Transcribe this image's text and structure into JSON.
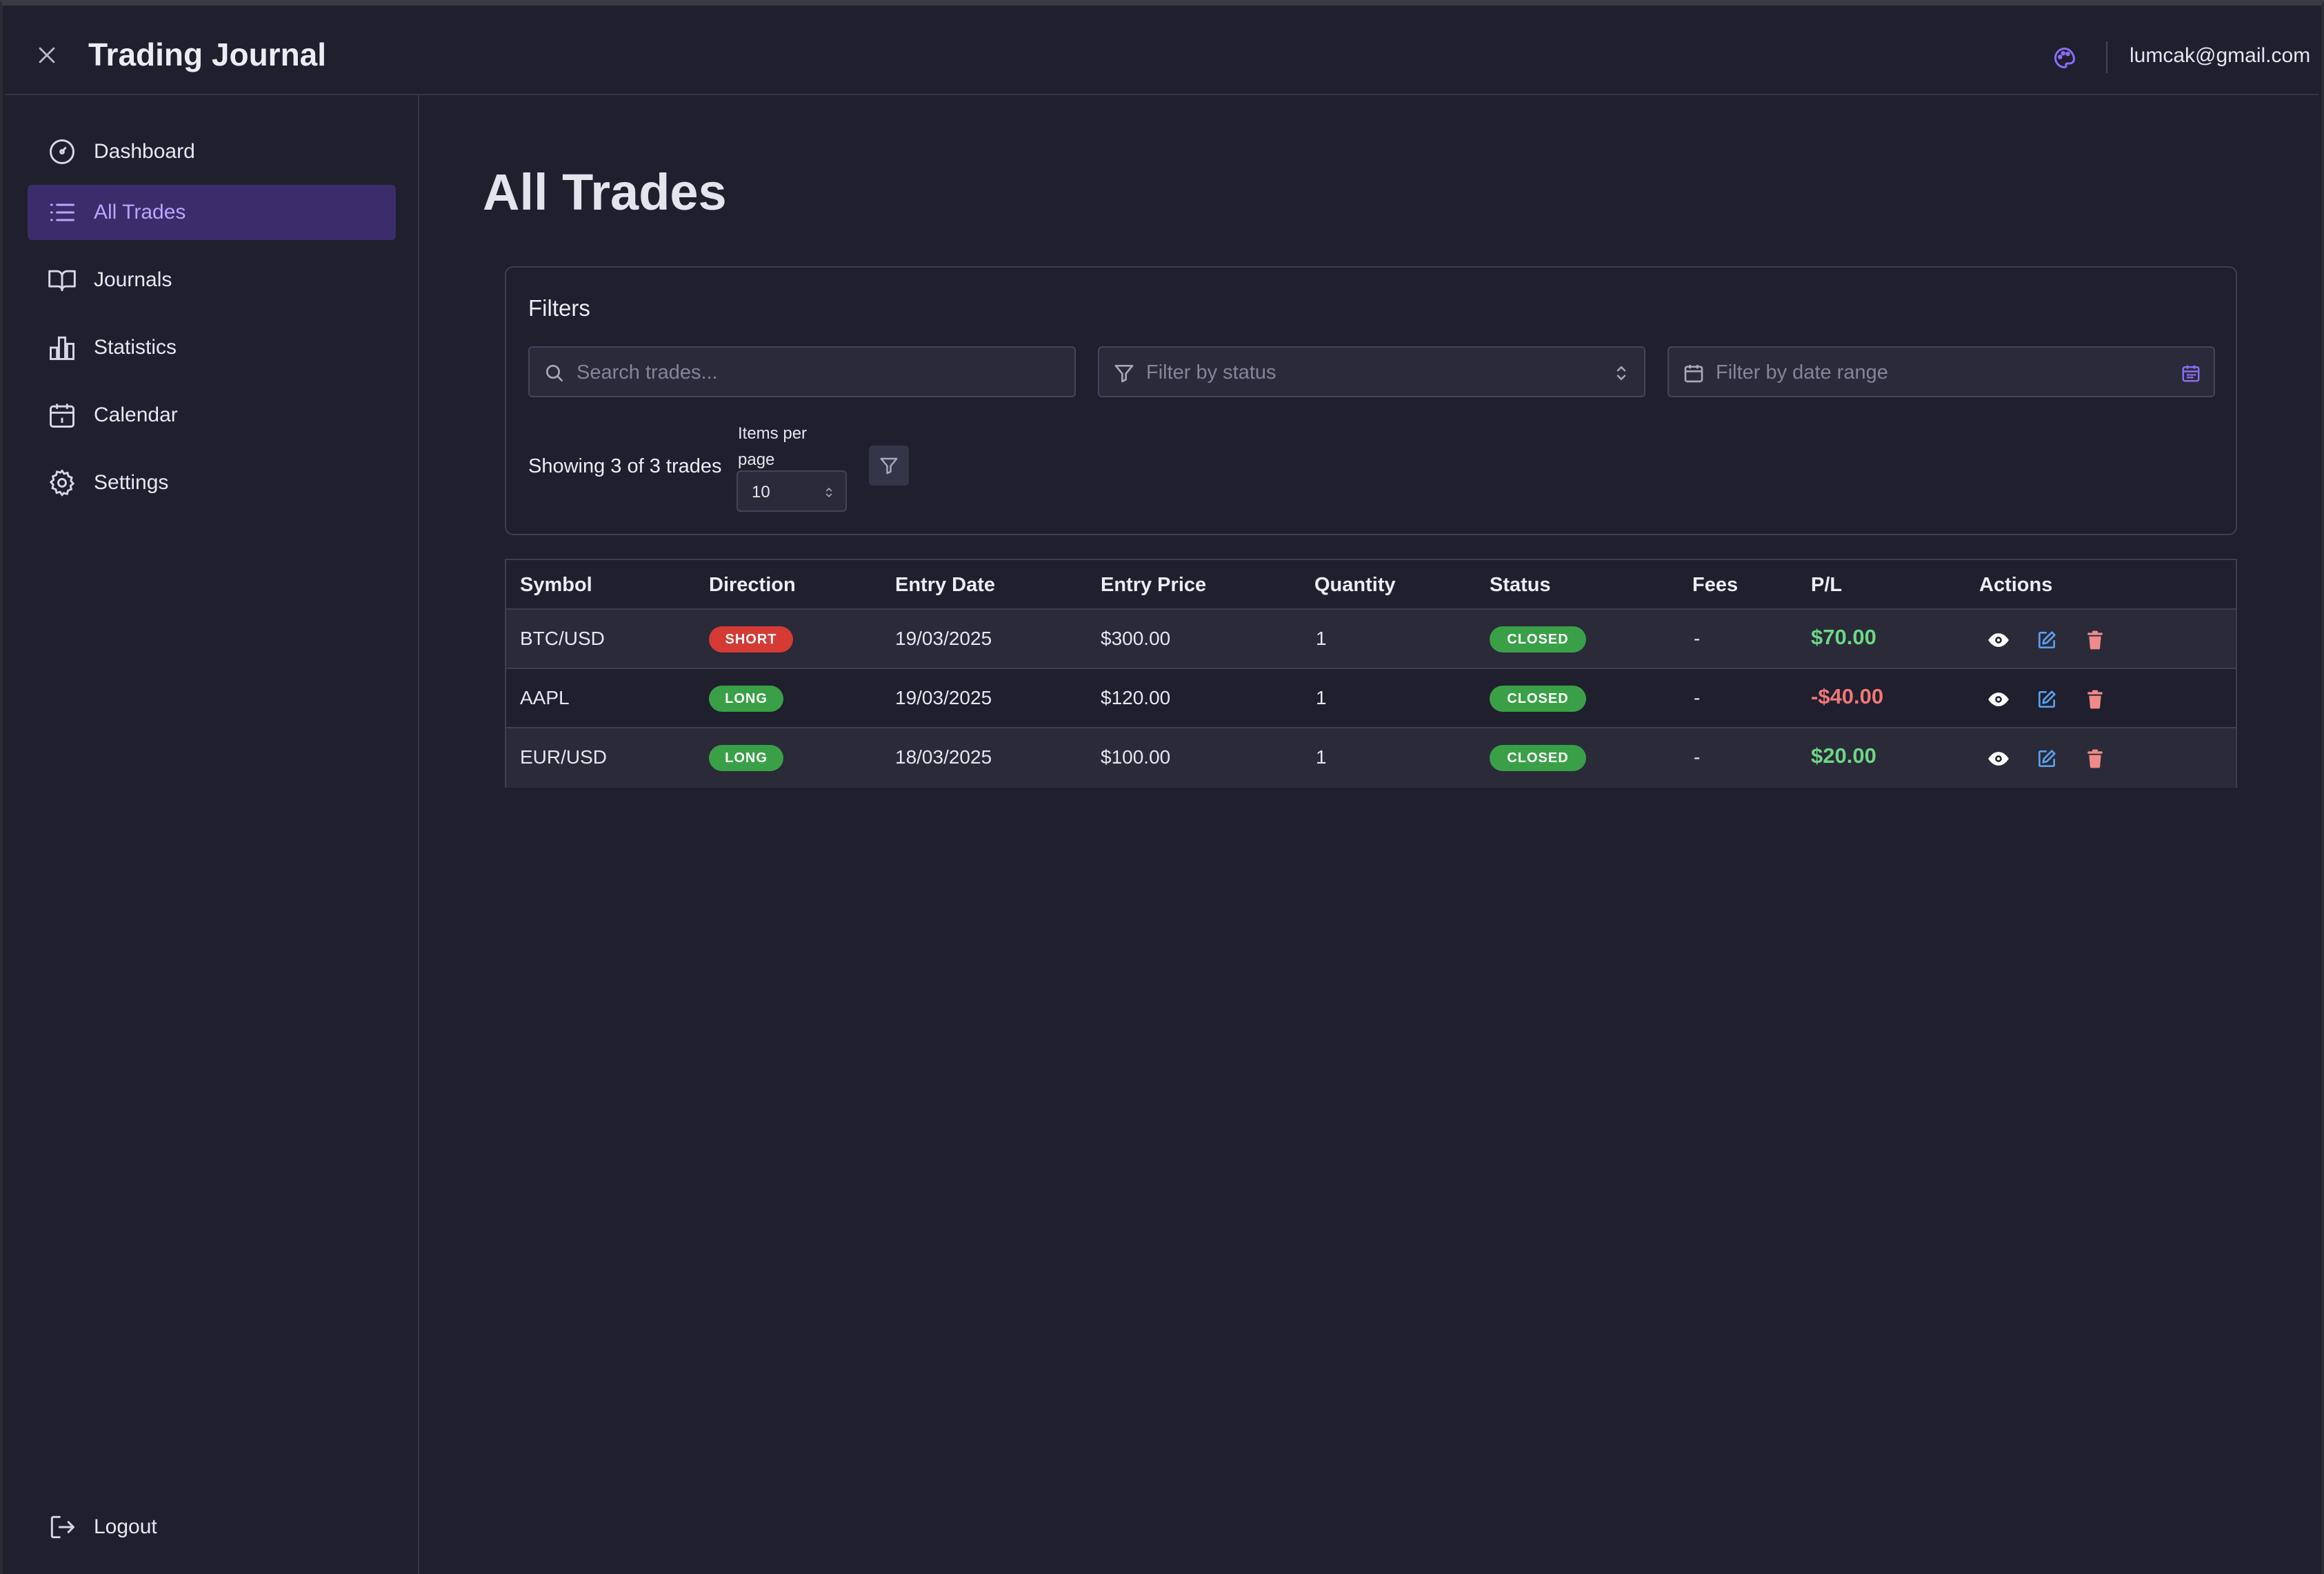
{
  "header": {
    "title": "Trading Journal",
    "user_email": "lumcak@gmail.com"
  },
  "sidebar": {
    "items": [
      {
        "label": "Dashboard",
        "icon": "gauge-icon"
      },
      {
        "label": "All Trades",
        "icon": "list-icon",
        "active": true
      },
      {
        "label": "Journals",
        "icon": "book-icon"
      },
      {
        "label": "Statistics",
        "icon": "bar-chart-icon"
      },
      {
        "label": "Calendar",
        "icon": "calendar-icon"
      },
      {
        "label": "Settings",
        "icon": "gear-icon"
      }
    ],
    "logout_label": "Logout"
  },
  "main": {
    "title": "All Trades",
    "filters": {
      "title": "Filters",
      "search_placeholder": "Search trades...",
      "status_placeholder": "Filter by status",
      "date_placeholder": "Filter by date range",
      "showing_text": "Showing 3 of 3 trades",
      "items_per_page_label": "Items per page",
      "items_per_page_value": "10"
    },
    "table": {
      "columns": [
        "Symbol",
        "Direction",
        "Entry Date",
        "Entry Price",
        "Quantity",
        "Status",
        "Fees",
        "P/L",
        "Actions"
      ],
      "rows": [
        {
          "symbol": "BTC/USD",
          "direction": "SHORT",
          "entry_date": "19/03/2025",
          "entry_price": "$300.00",
          "quantity": "1",
          "status": "CLOSED",
          "fees": "-",
          "pl": "$70.00"
        },
        {
          "symbol": "AAPL",
          "direction": "LONG",
          "entry_date": "19/03/2025",
          "entry_price": "$120.00",
          "quantity": "1",
          "status": "CLOSED",
          "fees": "-",
          "pl": "-$40.00"
        },
        {
          "symbol": "EUR/USD",
          "direction": "LONG",
          "entry_date": "18/03/2025",
          "entry_price": "$100.00",
          "quantity": "1",
          "status": "CLOSED",
          "fees": "-",
          "pl": "$20.00"
        }
      ]
    }
  },
  "colors": {
    "background": "#1f1f2e",
    "accent": "#8b6cf6",
    "active_nav_bg": "#3b2d6b",
    "short_badge": "#d53a34",
    "long_badge": "#3aa048",
    "profit": "#6cd785",
    "loss": "#f07878",
    "edit_icon": "#5aa0f0",
    "delete_icon": "#f08a8a"
  }
}
